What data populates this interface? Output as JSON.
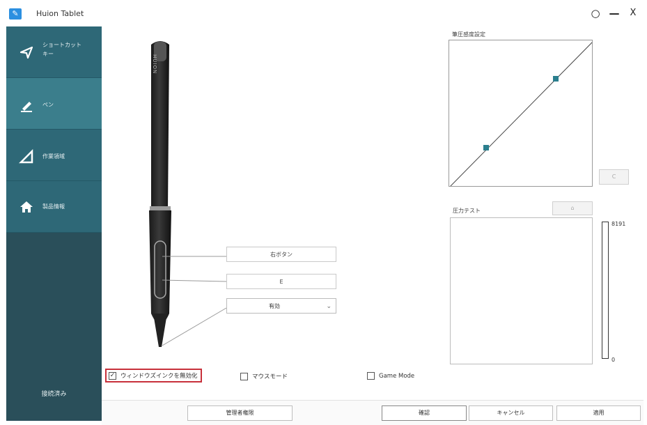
{
  "window": {
    "title": "Huion Tablet",
    "app_icon_glyph": "✎"
  },
  "sidebar": {
    "items": [
      {
        "label": "ショートカット\nキー",
        "icon": "send-icon"
      },
      {
        "label": "ペン",
        "icon": "pen-icon"
      },
      {
        "label": "作業領域",
        "icon": "triangle-ruler-icon"
      },
      {
        "label": "製品情報",
        "icon": "home-icon"
      }
    ],
    "active_index": 1,
    "status": "接続済み"
  },
  "pen": {
    "brand_text": "HUION",
    "upper_button": "右ボタン",
    "lower_button": "E",
    "tip_select": "有効"
  },
  "pressure_curve": {
    "title": "筆圧感度設定",
    "reset_label": "C"
  },
  "pressure_test": {
    "title": "圧力テスト",
    "clear_icon": "eraser-icon",
    "max_value": "8191",
    "min_value": "0",
    "level": 0
  },
  "options": {
    "windows_ink": {
      "label": "ウィンドウズインクを無効化",
      "checked": true
    },
    "mouse_mode": {
      "label": "マウスモード",
      "checked": false
    },
    "game_mode": {
      "label": "Game Mode",
      "checked": false
    }
  },
  "footer": {
    "admin": "管理者権限",
    "ok": "確認",
    "cancel": "キャンセル",
    "apply": "適用"
  },
  "colors": {
    "sidebar_bg": "#2a4f5a",
    "sidebar_item": "#2e6877",
    "sidebar_active": "#3b7e8c",
    "curve_point": "#2b7f8e",
    "highlight_border": "#c7303a"
  }
}
